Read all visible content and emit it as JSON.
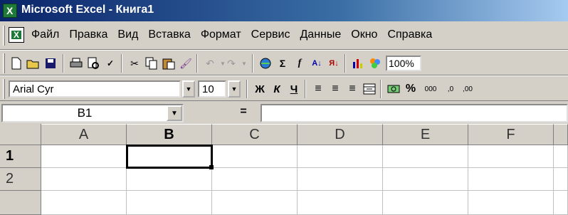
{
  "window": {
    "title": "Microsoft Excel - Книга1"
  },
  "menu": {
    "items": [
      "Файл",
      "Правка",
      "Вид",
      "Вставка",
      "Формат",
      "Сервис",
      "Данные",
      "Окно",
      "Справка"
    ]
  },
  "toolbar_standard": {
    "icons": [
      "new-icon",
      "open-icon",
      "save-icon",
      "print-icon",
      "print-preview-icon",
      "spelling-icon",
      "cut-icon",
      "copy-icon",
      "paste-icon",
      "format-painter-icon",
      "undo-icon",
      "redo-icon",
      "hyperlink-icon",
      "autosum-icon",
      "function-icon",
      "sort-ascending-icon",
      "sort-descending-icon",
      "chart-wizard-icon",
      "drawing-icon"
    ],
    "zoom": "100%"
  },
  "toolbar_formatting": {
    "font_name": "Arial Cyr",
    "font_size": "10",
    "bold_label": "Ж",
    "italic_label": "К",
    "underline_label": "Ч",
    "percent_label": "%",
    "thousands_label": "000"
  },
  "formula_bar": {
    "name_box": "B1",
    "equals_label": "=",
    "formula": ""
  },
  "sheet": {
    "columns": [
      "A",
      "B",
      "C",
      "D",
      "E",
      "F"
    ],
    "rows": [
      "1",
      "2"
    ],
    "active_cell": "B1"
  },
  "colors": {
    "title_gradient_start": "#0a246a",
    "title_gradient_end": "#a6caf0",
    "chrome": "#d4d0c8"
  }
}
